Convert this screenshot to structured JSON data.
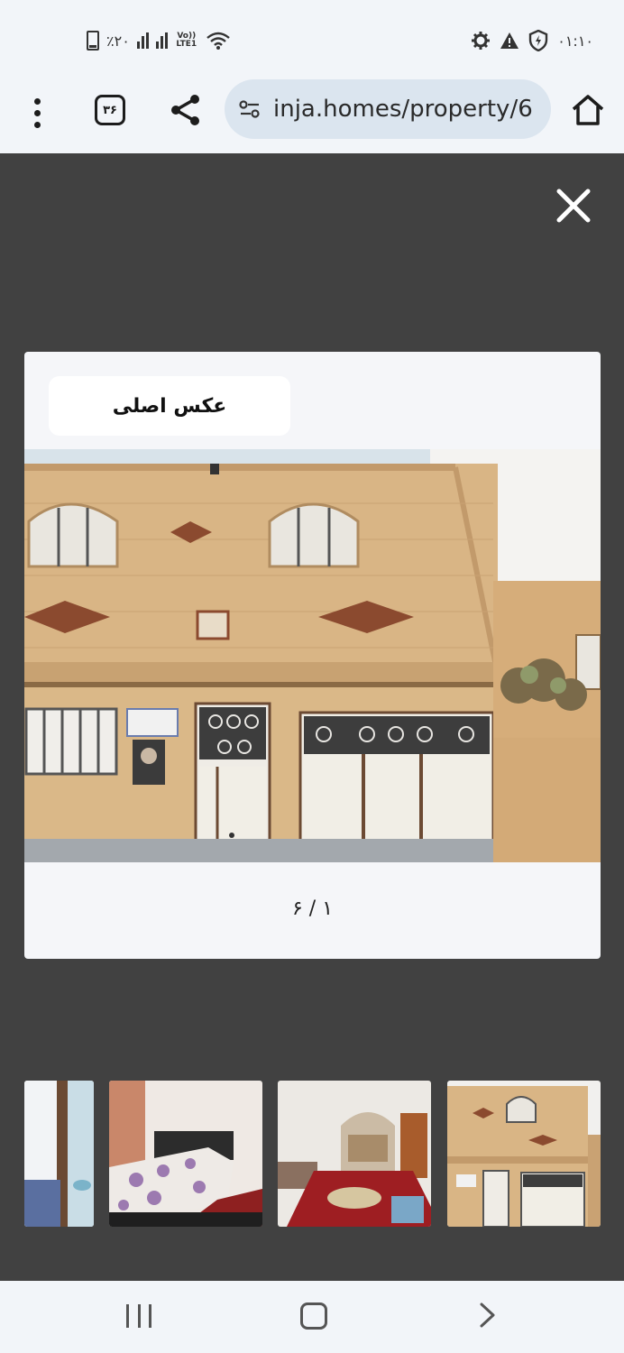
{
  "status_bar": {
    "battery": "٪۲۰",
    "network": "Vo)) LTE1",
    "time": "۰۱:۱۰"
  },
  "browser": {
    "tab_count": "۳۶",
    "url": "inja.homes/property/6"
  },
  "gallery": {
    "label": "عکس اصلی",
    "counter": "۱ / ۶",
    "thumbnails": [
      "bathroom",
      "bedroom",
      "living-room",
      "building-facade"
    ]
  },
  "colors": {
    "overlay": "#414141",
    "url_bar": "#dbe5ef",
    "facade": "#d9b585"
  }
}
